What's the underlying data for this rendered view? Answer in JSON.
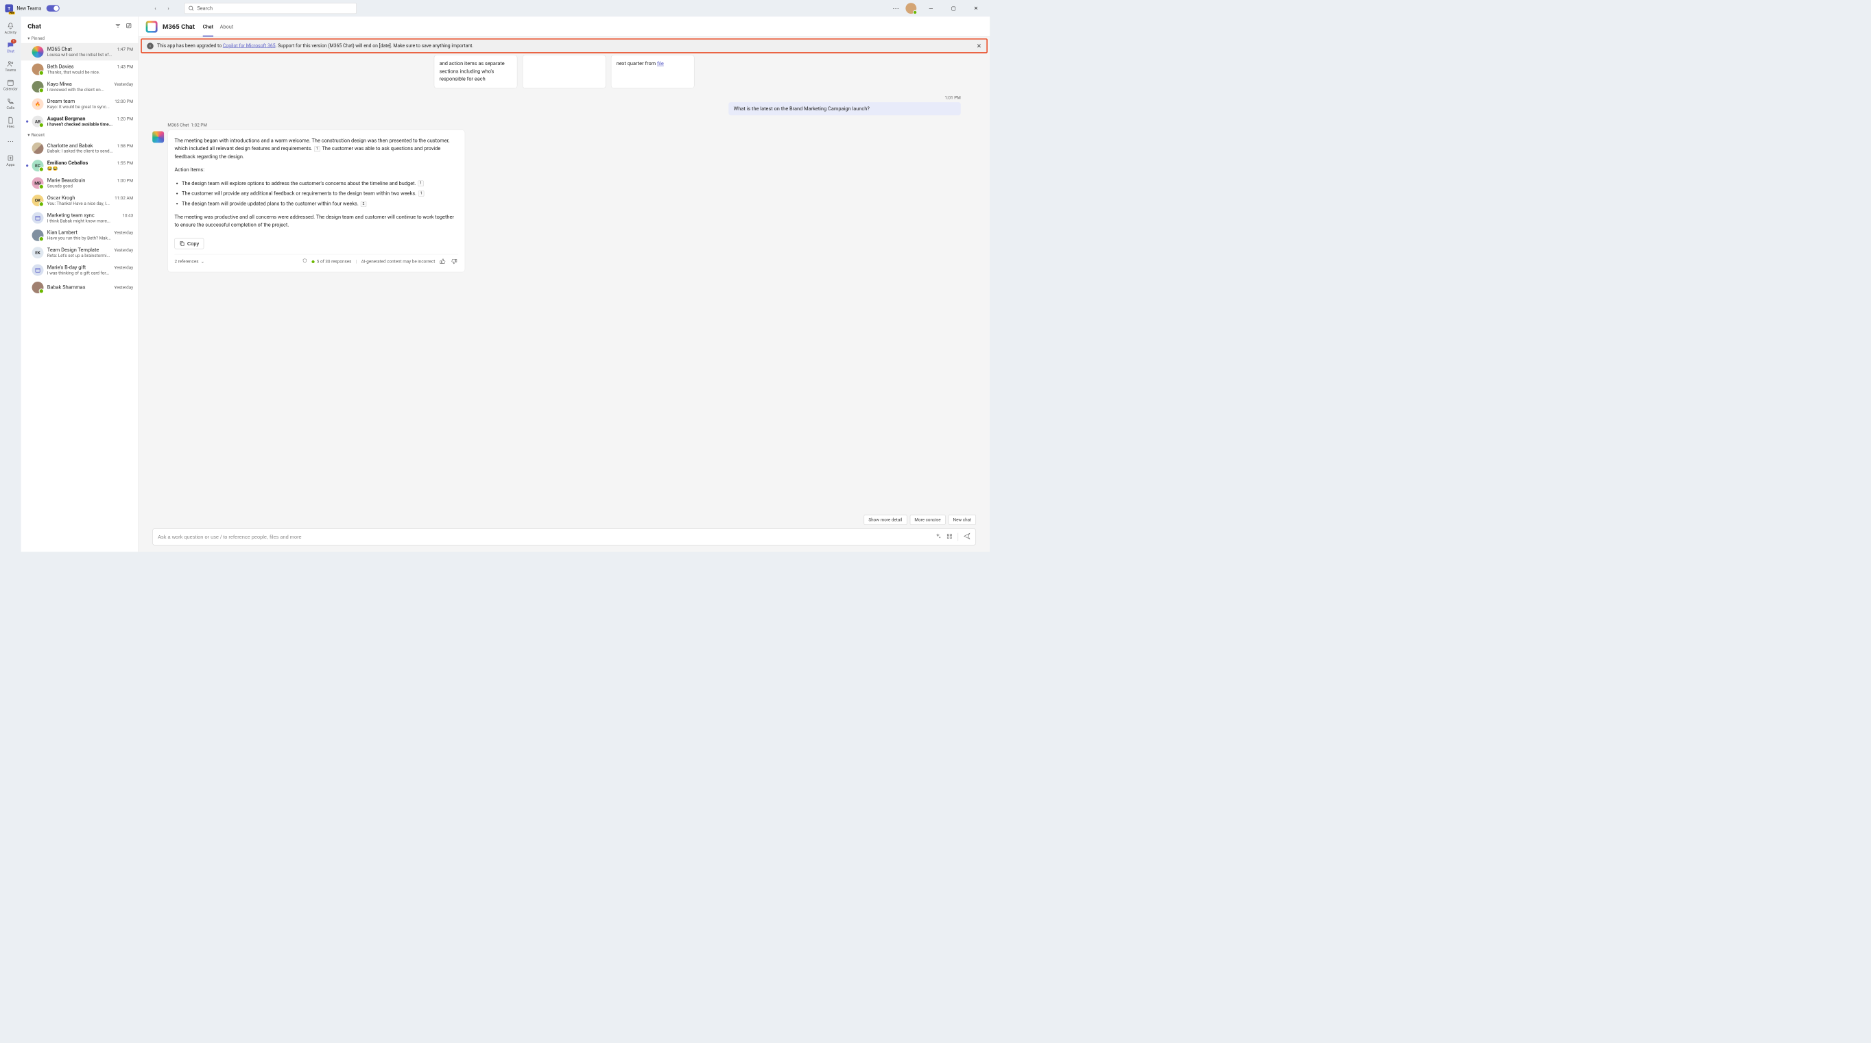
{
  "titlebar": {
    "app_name": "New Teams",
    "search_placeholder": "Search"
  },
  "rail": {
    "activity": "Activity",
    "chat": "Chat",
    "chat_badge": "1",
    "teams": "Teams",
    "calendar": "Calendar",
    "calls": "Calls",
    "files": "Files",
    "apps": "Apps"
  },
  "sidebar": {
    "title": "Chat",
    "pinned_label": "Pinned",
    "recent_label": "Recent",
    "pinned": [
      {
        "name": "M365 Chat",
        "preview": "Louisa will send the initial list of...",
        "time": "1:47 PM",
        "avatar": "copilot"
      },
      {
        "name": "Beth Davies",
        "preview": "Thanks, that would be nice.",
        "time": "1:43 PM",
        "avatar": "photo",
        "color": "#c09068"
      },
      {
        "name": "Kayo Miwa",
        "preview": "I reviewed with the client on...",
        "time": "Yesterday",
        "avatar": "photo",
        "color": "#7a8a60"
      },
      {
        "name": "Dream team",
        "preview": "Kayo: It would be great to sync...",
        "time": "12:00 PM",
        "avatar": "fire",
        "color": "#ffe0cc"
      },
      {
        "name": "August Bergman",
        "preview": "I haven't checked available time...",
        "time": "1:20 PM",
        "avatar": "AB",
        "color": "#e8e8e8",
        "bold": true,
        "unread": true
      }
    ],
    "recent": [
      {
        "name": "Charlotte and Babak",
        "preview": "Babak: I asked the client to send...",
        "time": "1:58 PM",
        "avatar": "group",
        "color": "#d0c0a0"
      },
      {
        "name": "Emiliano Ceballos",
        "preview": "😂😂",
        "time": "1:55 PM",
        "avatar": "EC",
        "color": "#a4e0c4",
        "bold": true,
        "unread": true
      },
      {
        "name": "Marie Beaudouin",
        "preview": "Sounds good",
        "time": "1:00 PM",
        "avatar": "MB",
        "color": "#e6a8c0"
      },
      {
        "name": "Oscar Krogh",
        "preview": "You: Thanks! Have a nice day, I...",
        "time": "11:02 AM",
        "avatar": "OK",
        "color": "#f4d480"
      },
      {
        "name": "Marketing team sync",
        "preview": "I think Babak might know more...",
        "time": "10:43",
        "avatar": "cal",
        "color": "#d8e0f0"
      },
      {
        "name": "Kian Lambert",
        "preview": "Have you run this by Beth? Mak...",
        "time": "Yesterday",
        "avatar": "photo",
        "color": "#8090a0"
      },
      {
        "name": "Team Design Template",
        "preview": "Reta: Let's set up a brainstormi...",
        "time": "Yesterday",
        "avatar": "EK",
        "color": "#e0e8f0"
      },
      {
        "name": "Marie's B-day gift",
        "preview": "I was thinking of a gift card for...",
        "time": "Yesterday",
        "avatar": "cal",
        "color": "#d8e0f0"
      },
      {
        "name": "Babak Shammas",
        "preview": "",
        "time": "Yesterday",
        "avatar": "photo",
        "color": "#a08070"
      }
    ]
  },
  "header": {
    "title": "M365 Chat",
    "tabs": {
      "chat": "Chat",
      "about": "About"
    }
  },
  "banner": {
    "text_before": "This app has been upgraded to ",
    "link_text": "Copilot for Microsoft 365",
    "text_after": ". Support for this version (M365 Chat) will end on [date]. Make sure to save anything important."
  },
  "cards": {
    "c1": "and action items as separate sections including who's responsible for each",
    "c2": "",
    "c3_prefix": "next quarter from ",
    "c3_link": "file"
  },
  "conversation": {
    "user_time": "1:01 PM",
    "user_msg": "What is the latest on the Brand Marketing Campaign launch?",
    "bot_name": "M365 Chat",
    "bot_time": "1:02 PM",
    "bot_p1a": "The meeting began with introductions and a warm welcome. The construction design was then presented to the customer, which included all relevant design features and requirements.",
    "bot_p1b": "The customer was able to ask questions and provide feedback regarding the design.",
    "bot_actions_title": "Action Items:",
    "bot_li1": "The design team will explore options to address the customer's concerns about the timeline and budget.",
    "bot_li2": "The customer will provide any additional feedback or requirements to the design team within two weeks.",
    "bot_li3": "The design team will provide updated plans to the customer within four weeks.",
    "bot_p2": "The meeting was productive and all concerns were addressed. The design team and customer will continue to work together to ensure the successful completion of the project.",
    "copy_label": "Copy",
    "refs_label": "2 references",
    "resp_count": "5 of 30 responses",
    "ai_note": "AI-generated content may be incorrect",
    "refs": {
      "r1": "1",
      "r2": "1",
      "r3": "1",
      "r4": "2"
    }
  },
  "chips": {
    "detail": "Show more detail",
    "concise": "More concise",
    "newchat": "New chat"
  },
  "composer": {
    "placeholder": "Ask a work question or use / to reference people, files and more"
  }
}
